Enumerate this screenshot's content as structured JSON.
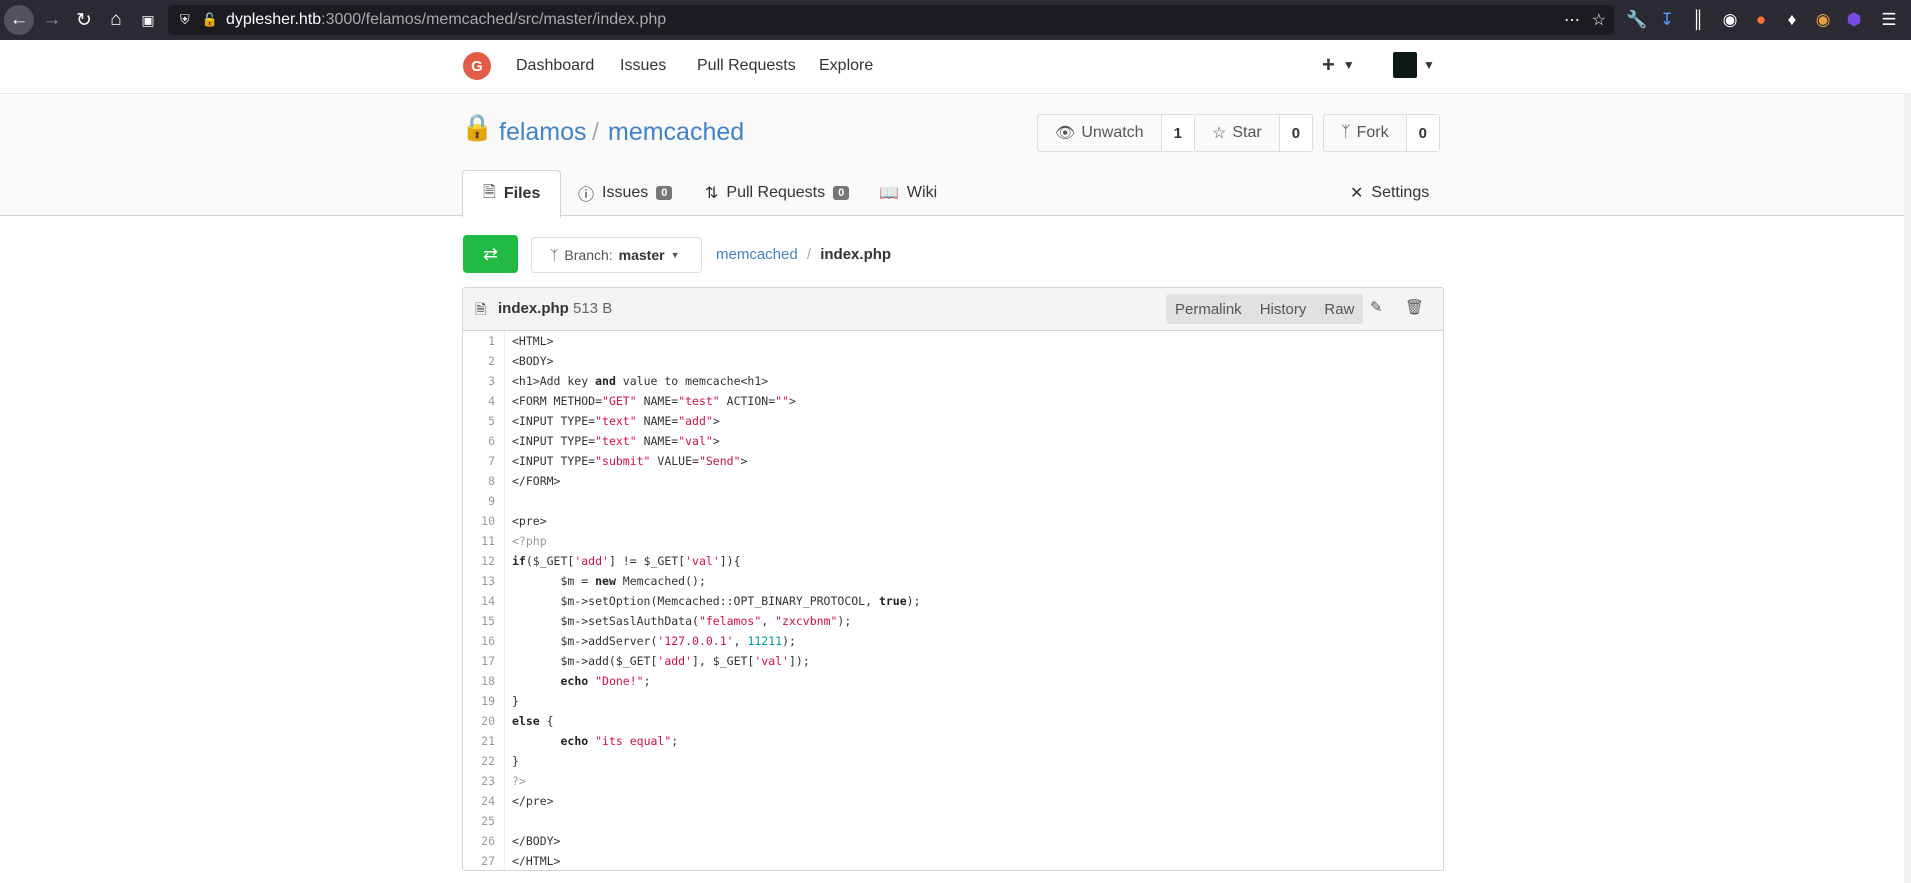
{
  "browser": {
    "url_host": "dyplesher.htb",
    "url_rest": ":3000/felamos/memcached/src/master/index.php"
  },
  "nav": {
    "items": [
      "Dashboard",
      "Issues",
      "Pull Requests",
      "Explore"
    ],
    "create_label": "+"
  },
  "repo": {
    "owner": "felamos",
    "separator": "/",
    "name": "memcached",
    "watch": {
      "label": "Unwatch",
      "count": "1"
    },
    "star": {
      "label": "Star",
      "count": "0"
    },
    "fork": {
      "label": "Fork",
      "count": "0"
    }
  },
  "tabs": [
    {
      "label": "Files"
    },
    {
      "label": "Issues",
      "badge": "0"
    },
    {
      "label": "Pull Requests",
      "badge": "0"
    },
    {
      "label": "Wiki"
    },
    {
      "label": "Settings"
    }
  ],
  "branch": {
    "prefix": "Branch:",
    "name": "master"
  },
  "breadcrumb": {
    "repo": "memcached",
    "sep": "/",
    "file": "index.php"
  },
  "file": {
    "name": "index.php",
    "size": "513 B",
    "actions": [
      "Permalink",
      "History",
      "Raw"
    ]
  },
  "code_lines": [
    "<HTML>",
    "<BODY>",
    "<h1>Add key and value to memcache<h1>",
    "<FORM METHOD=\"GET\" NAME=\"test\" ACTION=\"\">",
    "<INPUT TYPE=\"text\" NAME=\"add\">",
    "<INPUT TYPE=\"text\" NAME=\"val\">",
    "<INPUT TYPE=\"submit\" VALUE=\"Send\">",
    "</FORM>",
    "",
    "<pre>",
    "<?php",
    "if($_GET['add'] != $_GET['val']){",
    "       $m = new Memcached();",
    "       $m->setOption(Memcached::OPT_BINARY_PROTOCOL, true);",
    "       $m->setSaslAuthData(\"felamos\", \"zxcvbnm\");",
    "       $m->addServer('127.0.0.1', 11211);",
    "       $m->add($_GET['add'], $_GET['val']);",
    "       echo \"Done!\";",
    "}",
    "else {",
    "       echo \"its equal\";",
    "}",
    "?>",
    "</pre>",
    "",
    "</BODY>",
    "</HTML>"
  ],
  "colors": {
    "accent": "#4183c4",
    "green": "#21ba45",
    "string": "#d01040",
    "number": "#009999"
  }
}
